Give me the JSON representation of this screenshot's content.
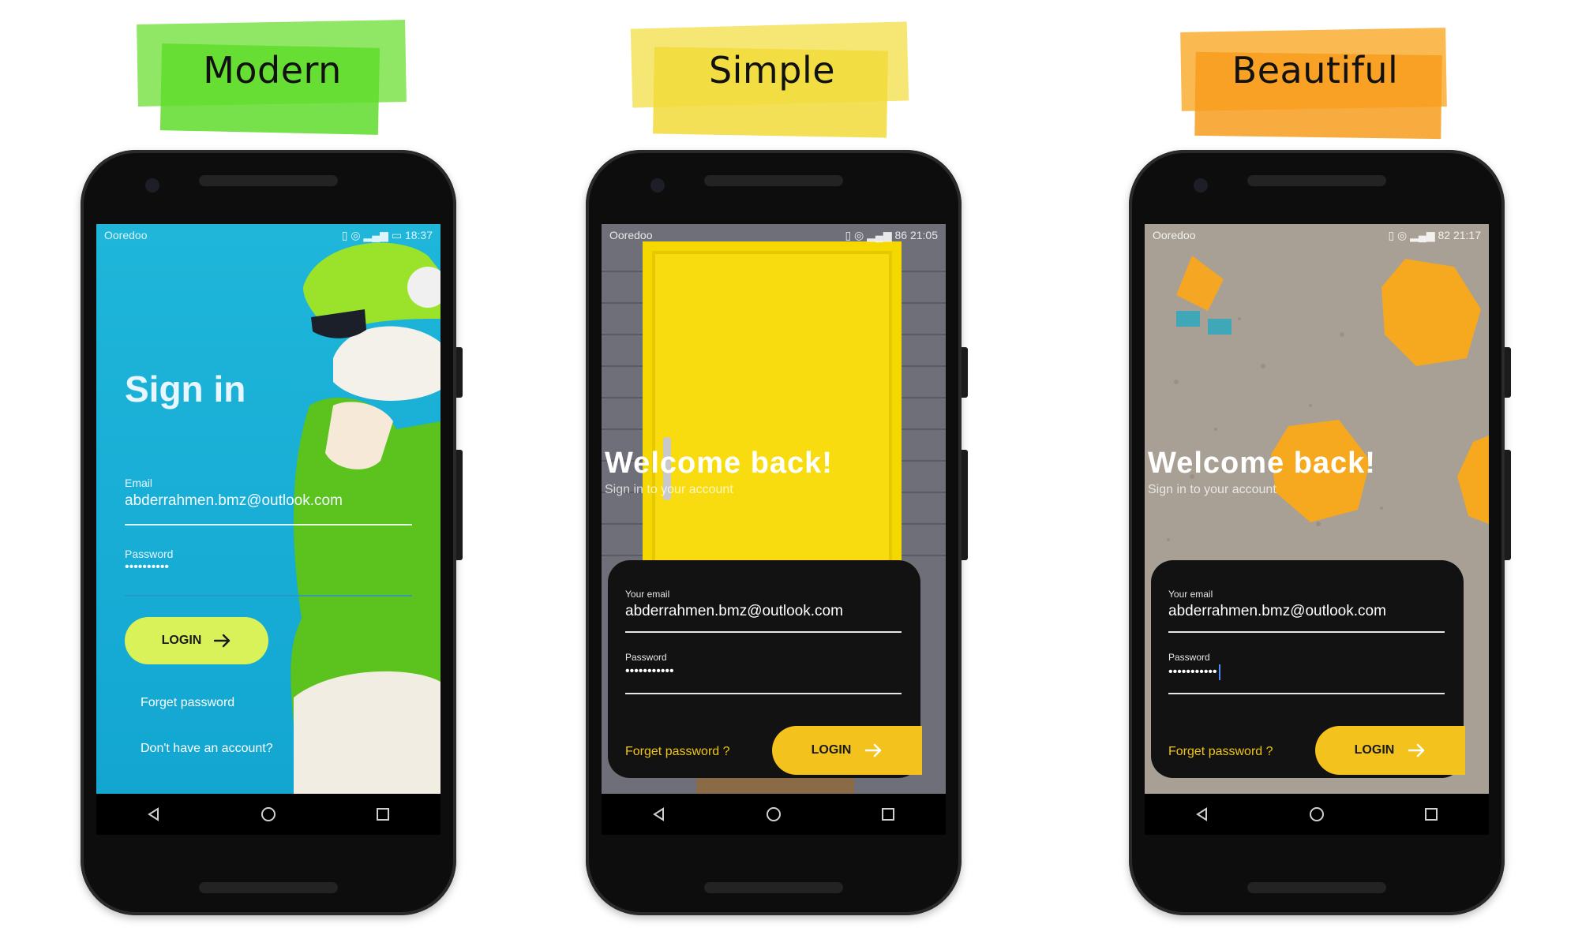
{
  "labels": {
    "modern": "Modern",
    "simple": "Simple",
    "beautiful": "Beautiful"
  },
  "colors": {
    "modern_highlight": "#6de63d",
    "simple_highlight": "#f2df45",
    "beautiful_highlight": "#f9a826",
    "modern_login": "#d9f25a",
    "card_login": "#f4c21c",
    "forgot_link": "#f0c419"
  },
  "phones": {
    "modern": {
      "carrier": "Ooredoo",
      "status_icons": "▯ ◎ ▂▄▆ ▭",
      "time": "18:37",
      "title": "Sign in",
      "email_label": "Email",
      "email_value": "abderrahmen.bmz@outlook.com",
      "password_label": "Password",
      "password_value": "••••••••••",
      "login_label": "LOGIN",
      "forget_link": "Forget password",
      "signup_link": "Don't have an account?"
    },
    "simple": {
      "carrier": "Ooredoo",
      "status_icons": "▯ ◎ ▂▄▆ 86",
      "time": "21:05",
      "welcome": "Welcome back!",
      "subtitle": "Sign in to your account",
      "email_label": "Your email",
      "email_value": "abderrahmen.bmz@outlook.com",
      "password_label": "Password",
      "password_value": "•••••••••••",
      "forget_link": "Forget password ?",
      "login_label": "LOGIN"
    },
    "beautiful": {
      "carrier": "Ooredoo",
      "status_icons": "▯ ◎ ▂▄▆ 82",
      "time": "21:17",
      "welcome": "Welcome back!",
      "subtitle": "Sign in to your account",
      "email_label": "Your email",
      "email_value": "abderrahmen.bmz@outlook.com",
      "password_label": "Password",
      "password_value": "•••••••••••",
      "forget_link": "Forget password ?",
      "login_label": "LOGIN"
    }
  },
  "nav_icons": [
    "back-icon",
    "home-icon",
    "recents-icon"
  ]
}
